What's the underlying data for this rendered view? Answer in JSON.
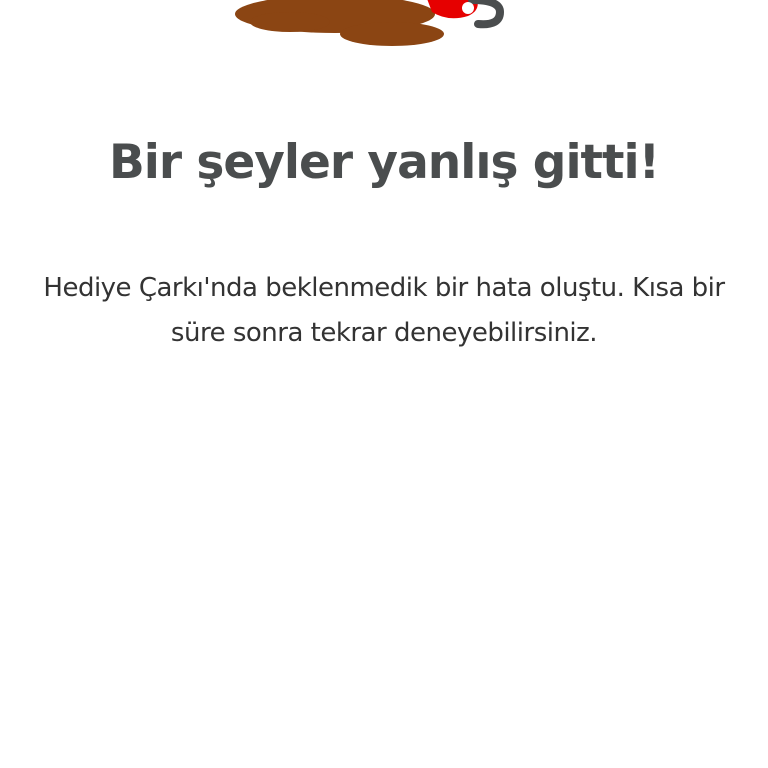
{
  "error_page": {
    "illustration_icon": "spilled-coffee-icon",
    "title": "Bir şeyler yanlış gitti!",
    "message": "Hediye Çarkı'nda beklenmedik bir hata oluştu. Kısa bir süre sonra tekrar deneyebilirsiniz."
  },
  "colors": {
    "spill": "#8b4513",
    "cup_red": "#e60000",
    "cup_handle": "#4a4d4e",
    "title_text": "#4a4d4e",
    "body_text": "#333333"
  }
}
